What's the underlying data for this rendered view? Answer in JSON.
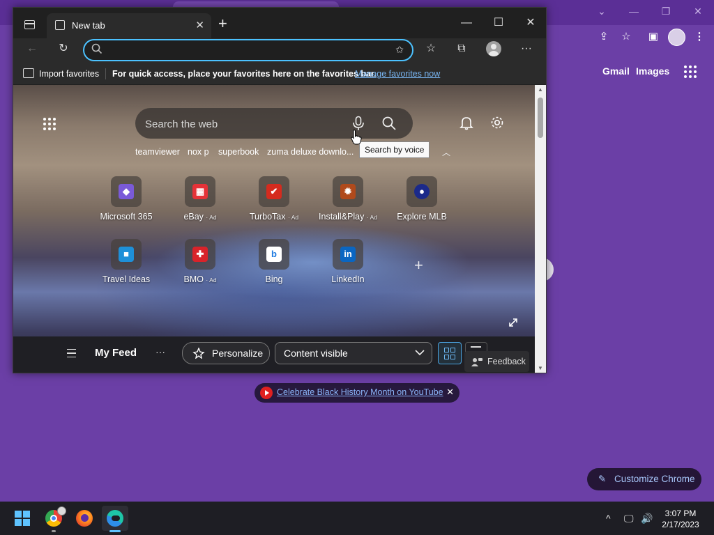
{
  "colors": {
    "desktop": "#6a3fa4",
    "edge_accent": "#4cc2ff",
    "link": "#78b4f0",
    "youtube_red": "#e02020"
  },
  "chrome_background": {
    "links": {
      "gmail": "Gmail",
      "images": "Images"
    },
    "icons": [
      "share-icon",
      "star-icon",
      "sidepanel-icon",
      "profile-avatar",
      "menu-icon"
    ],
    "banner": {
      "link_text": "Celebrate Black History Month on YouTube"
    },
    "customize_label": "Customize Chrome"
  },
  "edge": {
    "tab": {
      "title": "New tab"
    },
    "address": {
      "placeholder": ""
    },
    "favorites_bar": {
      "import_label": "Import favorites",
      "hint": "For quick access, place your favorites here on the favorites bar.",
      "manage_link": "Manage favorites now"
    },
    "ntp": {
      "search_placeholder": "Search the web",
      "suggestions": [
        "teamviewer",
        "nox p",
        "superbook",
        "zuma deluxe downlo..."
      ],
      "tooltip": "Search by voice",
      "tiles": [
        {
          "label": "Microsoft 365",
          "ad": "",
          "icon": "microsoft-365-icon",
          "color": "#7a5ad8"
        },
        {
          "label": "eBay",
          "ad": "· Ad",
          "icon": "ebay-icon",
          "color": "#e53238"
        },
        {
          "label": "TurboTax",
          "ad": "· Ad",
          "icon": "turbotax-icon",
          "color": "#d52b1e"
        },
        {
          "label": "Install&Play",
          "ad": "· Ad",
          "icon": "install-play-icon",
          "color": "#b04a1c"
        },
        {
          "label": "Explore MLB",
          "ad": "",
          "icon": "mlb-icon",
          "color": "#1b2a8a"
        },
        {
          "label": "Travel Ideas",
          "ad": "",
          "icon": "travel-ideas-icon",
          "color": "#1e90d8"
        },
        {
          "label": "BMO",
          "ad": "· Ad",
          "icon": "bmo-icon",
          "color": "#d8232a"
        },
        {
          "label": "Bing",
          "ad": "",
          "icon": "bing-icon",
          "color": "#ffffff"
        },
        {
          "label": "LinkedIn",
          "ad": "",
          "icon": "linkedin-icon",
          "color": "#0a66c2"
        }
      ],
      "tile_glyphs": [
        "◆",
        "▦",
        "✔",
        "✹",
        "●",
        "■",
        "✚",
        "b",
        "in"
      ]
    },
    "feed": {
      "title": "My Feed",
      "more": "···",
      "personalize": "Personalize",
      "content_visible": "Content visible",
      "feedback": "Feedback"
    }
  },
  "taskbar": {
    "apps": [
      "windows-start",
      "google-chrome",
      "firefox",
      "microsoft-edge"
    ],
    "time": "3:07 PM",
    "date": "2/17/2023"
  }
}
